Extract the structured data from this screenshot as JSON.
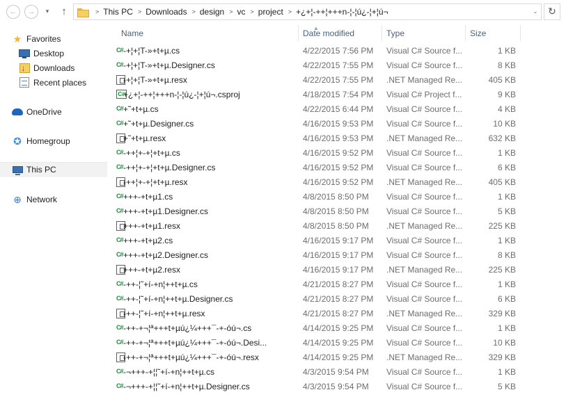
{
  "addressbar": {
    "back_icon": "←",
    "forward_icon": "→",
    "recent_icon": "▾",
    "up_icon": "↑",
    "dropdown_icon": "⌄",
    "refresh_icon": "↻",
    "breadcrumbs": [
      {
        "label": "This PC"
      },
      {
        "label": "Downloads"
      },
      {
        "label": "design"
      },
      {
        "label": "vc"
      },
      {
        "label": "project"
      },
      {
        "label": "+¿+¦-++¦+++n-¦-¦ú¿-¦+¦ú¬"
      }
    ]
  },
  "sidebar": {
    "favorites": "Favorites",
    "desktop": "Desktop",
    "downloads": "Downloads",
    "recent": "Recent places",
    "onedrive": "OneDrive",
    "homegroup": "Homegroup",
    "thispc": "This PC",
    "network": "Network"
  },
  "columns": {
    "name": "Name",
    "date": "Date modified",
    "type": "Type",
    "size": "Size"
  },
  "files": [
    {
      "icon": "cs-icon",
      "name": "-+¦+¦T-»+t+µ.cs",
      "date": "4/22/2015 7:56 PM",
      "type": "Visual C# Source f...",
      "size": "1 KB"
    },
    {
      "icon": "cs-icon",
      "name": "-+¦+¦T-»+t+µ.Designer.cs",
      "date": "4/22/2015 7:55 PM",
      "type": "Visual C# Source f...",
      "size": "8 KB"
    },
    {
      "icon": "resx-icon",
      "name": "-+¦+¦T-»+t+µ.resx",
      "date": "4/22/2015 7:55 PM",
      "type": ".NET Managed Re...",
      "size": "405 KB"
    },
    {
      "icon": "csproj-icon",
      "name": "+¿+¦-++¦+++n-¦-¦ú¿-¦+¦ú¬.csproj",
      "date": "4/18/2015 7:54 PM",
      "type": "Visual C# Project f...",
      "size": "9 KB"
    },
    {
      "icon": "cs-icon",
      "name": "+˜+t+µ.cs",
      "date": "4/22/2015 6:44 PM",
      "type": "Visual C# Source f...",
      "size": "4 KB"
    },
    {
      "icon": "cs-icon",
      "name": "+˜+t+µ.Designer.cs",
      "date": "4/16/2015 9:53 PM",
      "type": "Visual C# Source f...",
      "size": "10 KB"
    },
    {
      "icon": "resx-icon",
      "name": "+˜+t+µ.resx",
      "date": "4/16/2015 9:53 PM",
      "type": ".NET Managed Re...",
      "size": "632 KB"
    },
    {
      "icon": "cs-icon",
      "name": "-++¦+-+¦+t+µ.cs",
      "date": "4/16/2015 9:52 PM",
      "type": "Visual C# Source f...",
      "size": "1 KB"
    },
    {
      "icon": "cs-icon",
      "name": "-++¦+-+¦+t+µ.Designer.cs",
      "date": "4/16/2015 9:52 PM",
      "type": "Visual C# Source f...",
      "size": "6 KB"
    },
    {
      "icon": "resx-icon",
      "name": "-++¦+-+¦+t+µ.resx",
      "date": "4/16/2015 9:52 PM",
      "type": ".NET Managed Re...",
      "size": "405 KB"
    },
    {
      "icon": "cs-icon",
      "name": "+++-+t+µ1.cs",
      "date": "4/8/2015 8:50 PM",
      "type": "Visual C# Source f...",
      "size": "1 KB"
    },
    {
      "icon": "cs-icon",
      "name": "+++-+t+µ1.Designer.cs",
      "date": "4/8/2015 8:50 PM",
      "type": "Visual C# Source f...",
      "size": "5 KB"
    },
    {
      "icon": "resx-icon",
      "name": "+++-+t+µ1.resx",
      "date": "4/8/2015 8:50 PM",
      "type": ".NET Managed Re...",
      "size": "225 KB"
    },
    {
      "icon": "cs-icon",
      "name": "+++-+t+µ2.cs",
      "date": "4/16/2015 9:17 PM",
      "type": "Visual C# Source f...",
      "size": "1 KB"
    },
    {
      "icon": "cs-icon",
      "name": "+++-+t+µ2.Designer.cs",
      "date": "4/16/2015 9:17 PM",
      "type": "Visual C# Source f...",
      "size": "8 KB"
    },
    {
      "icon": "resx-icon",
      "name": "+++-+t+µ2.resx",
      "date": "4/16/2015 9:17 PM",
      "type": ".NET Managed Re...",
      "size": "225 KB"
    },
    {
      "icon": "cs-icon",
      "name": "-++-¦˜+í-+n¦++t+µ.cs",
      "date": "4/21/2015 8:27 PM",
      "type": "Visual C# Source f...",
      "size": "1 KB"
    },
    {
      "icon": "cs-icon",
      "name": "-++-¦˜+í-+n¦++t+µ.Designer.cs",
      "date": "4/21/2015 8:27 PM",
      "type": "Visual C# Source f...",
      "size": "6 KB"
    },
    {
      "icon": "resx-icon",
      "name": "-++-¦˜+í-+n¦++t+µ.resx",
      "date": "4/21/2015 8:27 PM",
      "type": ".NET Managed Re...",
      "size": "329 KB"
    },
    {
      "icon": "cs-icon",
      "name": "-++-+¬¦ª+++t+µú¿¼+++¯-+-óú¬.cs",
      "date": "4/14/2015 9:25 PM",
      "type": "Visual C# Source f...",
      "size": "1 KB"
    },
    {
      "icon": "cs-icon",
      "name": "-++-+¬¦ª+++t+µú¿¼+++¯-+-óú¬.Desi...",
      "date": "4/14/2015 9:25 PM",
      "type": "Visual C# Source f...",
      "size": "10 KB"
    },
    {
      "icon": "resx-icon",
      "name": "-++-+¬¦ª+++t+µú¿¼+++¯-+-óú¬.resx",
      "date": "4/14/2015 9:25 PM",
      "type": ".NET Managed Re...",
      "size": "329 KB"
    },
    {
      "icon": "cs-icon",
      "name": "-¬+++-+¦¦˜+í-+n¦++t+µ.cs",
      "date": "4/3/2015 9:54 PM",
      "type": "Visual C# Source f...",
      "size": "1 KB"
    },
    {
      "icon": "cs-icon",
      "name": "-¬+++-+¦¦˜+í-+n¦++t+µ.Designer.cs",
      "date": "4/3/2015 9:54 PM",
      "type": "Visual C# Source f...",
      "size": "5 KB"
    }
  ]
}
